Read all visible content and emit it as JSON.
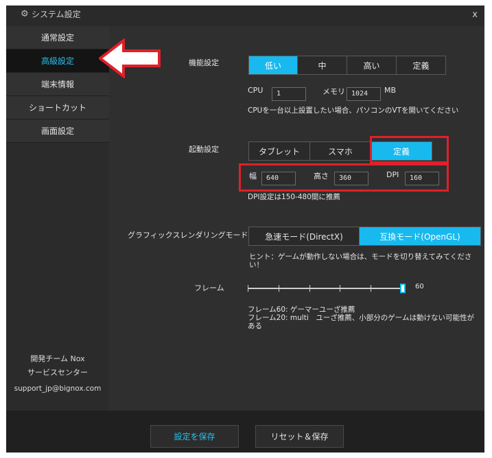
{
  "window": {
    "title": "システム設定",
    "close": "x"
  },
  "sidebar": {
    "items": [
      {
        "label": "通常設定"
      },
      {
        "label": "高級設定"
      },
      {
        "label": "端末情報"
      },
      {
        "label": "ショートカット"
      },
      {
        "label": "画面設定"
      }
    ],
    "footer_team": "開発チーム Nox",
    "footer_service": "サービスセンター",
    "footer_email": "support_jp@bignox.com"
  },
  "performance": {
    "label": "機能設定",
    "options": [
      "低い",
      "中",
      "高い",
      "定義"
    ],
    "selected": "低い",
    "cpu_label": "CPU",
    "cpu_value": "1",
    "memory_label": "メモリ",
    "memory_value": "1024",
    "memory_unit": "MB",
    "note": "CPUを一台以上設置したい場合、パソコンのVTを開いてください"
  },
  "startup": {
    "label": "起動設定",
    "options": [
      "タブレット",
      "スマホ",
      "定義"
    ],
    "selected": "定義",
    "width_label": "幅",
    "width_value": "640",
    "height_label": "高さ",
    "height_value": "360",
    "dpi_label": "DPI",
    "dpi_value": "160",
    "note": "DPI設定は150-480間に推薦"
  },
  "render": {
    "label": "グラフィックスレンダリングモード",
    "options": [
      "急速モード(DirectX)",
      "互換モード(OpenGL)"
    ],
    "selected": "互換モード(OpenGL)",
    "hint": "ヒント：ゲームが動作しない場合は、モードを切り替えてみてください！"
  },
  "frame": {
    "label": "フレーム",
    "value": "60",
    "level": 1.0,
    "note1": "フレーム60: ゲーマーユーざ推薦",
    "note2": "フレーム20: multi　ユーざ推薦、小部分のゲームは動けない可能性が",
    "note3": "ある"
  },
  "footer": {
    "save": "設定を保存",
    "reset_save": "リセット＆保存"
  },
  "colors": {
    "accent": "#18b9ef",
    "highlight": "#e0202a",
    "arrow": "#e0202a"
  }
}
